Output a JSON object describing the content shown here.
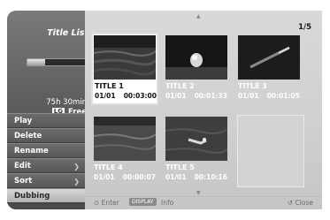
{
  "panel": {
    "title": "Title List",
    "remaining_time": "75h 30min",
    "disc_badge": "LG",
    "disc_status": "Free"
  },
  "menu": [
    {
      "label": "Play",
      "has_submenu": false
    },
    {
      "label": "Delete",
      "has_submenu": false
    },
    {
      "label": "Rename",
      "has_submenu": false
    },
    {
      "label": "Edit",
      "has_submenu": true
    },
    {
      "label": "Sort",
      "has_submenu": true
    },
    {
      "label": "Dubbing",
      "has_submenu": false,
      "selected": true
    }
  ],
  "page_indicator": "1/5",
  "titles": [
    {
      "title": "TITLE 1",
      "date": "01/01",
      "duration": "00:03:00",
      "selected": true
    },
    {
      "title": "TITLE 2",
      "date": "01/01",
      "duration": "00:01:33"
    },
    {
      "title": "TITLE 3",
      "date": "01/01",
      "duration": "00:01:05"
    },
    {
      "title": "TITLE 4",
      "date": "01/01",
      "duration": "00:00:07"
    },
    {
      "title": "TITLE 5",
      "date": "01/01",
      "duration": "00:10:16"
    }
  ],
  "footer": {
    "enter_label": "⊙ Enter",
    "display_key": "DISPLAY",
    "info_label": "Info",
    "close_label": "↺ Close"
  },
  "colors": {
    "panel_dark": "#5e5e5e",
    "main_bg": "#d9d9d9",
    "selected_bg": "#ffffff"
  },
  "icons": {
    "arrow": "chevron-right-icon",
    "scroll_up": "triangle-up-icon",
    "scroll_down": "triangle-down-icon",
    "enter": "enter-icon",
    "close": "return-icon"
  }
}
